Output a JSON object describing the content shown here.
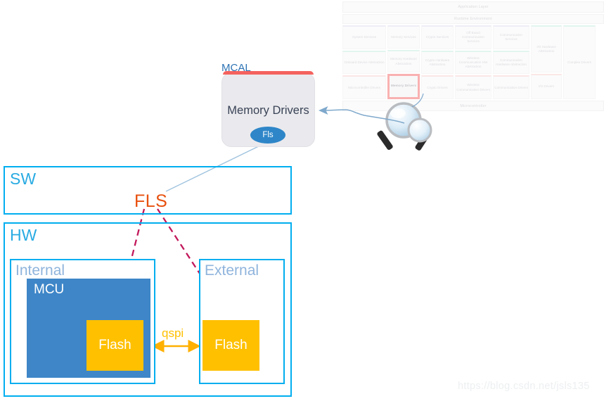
{
  "autosar": {
    "application_layer": "Application Layer",
    "runtime_environment": "Runtime Environment",
    "microcontroller": "Microcontroller",
    "columns": [
      {
        "cells": [
          {
            "label": "System Services",
            "accent": "t-purple",
            "rows": 1
          },
          {
            "label": "Onboard Device Abstraction",
            "accent": "t-green",
            "rows": 1
          },
          {
            "label": "Microcontroller Drivers",
            "accent": "t-red",
            "rows": 1
          }
        ]
      },
      {
        "cells": [
          {
            "label": "Memory Services",
            "accent": "t-purple",
            "rows": 1
          },
          {
            "label": "Memory Hardware Abstraction",
            "accent": "t-green",
            "rows": 1
          },
          {
            "label": "Memory Drivers",
            "accent": "t-red",
            "rows": 1,
            "highlighted": true
          }
        ]
      },
      {
        "cells": [
          {
            "label": "Crypto Services",
            "accent": "t-purple",
            "rows": 1
          },
          {
            "label": "Crypto Hardware Abstraction",
            "accent": "t-green",
            "rows": 1
          },
          {
            "label": "Crypto Drivers",
            "accent": "t-red",
            "rows": 1
          }
        ]
      },
      {
        "cells": [
          {
            "label": "Off Board Communication Services",
            "accent": "t-purple",
            "rows": 1
          },
          {
            "label": "Wireless Communication HW Abstraction",
            "accent": "t-green",
            "rows": 1
          },
          {
            "label": "Wireless Communication Drivers",
            "accent": "t-red",
            "rows": 1
          }
        ]
      },
      {
        "cells": [
          {
            "label": "Communication Services",
            "accent": "t-purple",
            "rows": 1
          },
          {
            "label": "Communication Hardware Abstraction",
            "accent": "t-green",
            "rows": 1
          },
          {
            "label": "Communication Drivers",
            "accent": "t-red",
            "rows": 1
          }
        ]
      },
      {
        "cells": [
          {
            "label": "I/O Hardware Abstraction",
            "accent": "t-green",
            "rows": 2
          },
          {
            "label": "I/O Drivers",
            "accent": "t-red",
            "rows": 1
          }
        ]
      },
      {
        "cells": [
          {
            "label": "Complex Drivers",
            "accent": "t-green",
            "rows": 3
          }
        ]
      }
    ],
    "highlight_color": "#ee0000"
  },
  "mcal": {
    "title": "MCAL",
    "module": "Memory Drivers",
    "api": "Fls",
    "accent_color": "#f4635f",
    "api_color": "#2e86c8"
  },
  "layers": {
    "sw": "SW",
    "hw": "HW",
    "internal": "Internal",
    "external": "External",
    "layer_color": "#00aeef",
    "sublayer_color": "#8fb4dc"
  },
  "hardware": {
    "mcu": "MCU",
    "flash_internal": "Flash",
    "flash_external": "Flash",
    "bus": "qspi",
    "mcu_color": "#3e86c8",
    "flash_color": "#ffc000"
  },
  "driver": {
    "name": "FLS",
    "color": "#e8500e"
  },
  "icons": {
    "magnifier": "magnifier-icon"
  },
  "watermark": "https://blog.csdn.net/jsls135"
}
